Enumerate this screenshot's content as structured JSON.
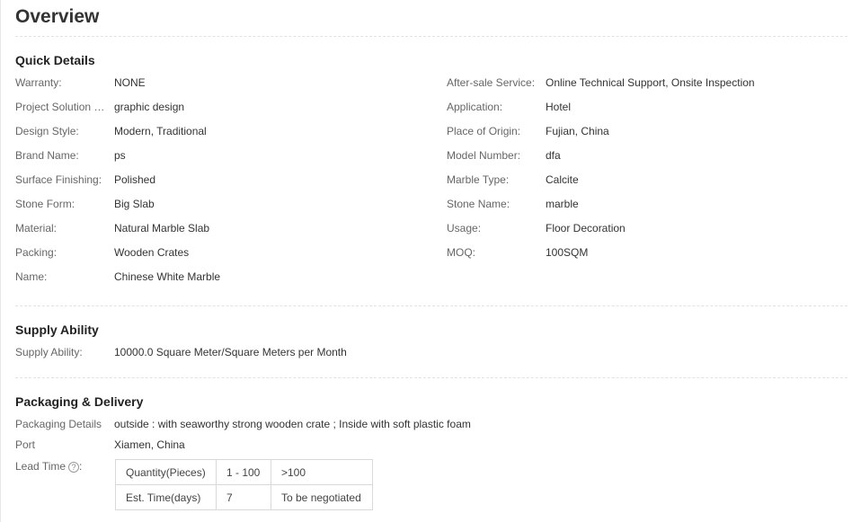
{
  "page_title": "Overview",
  "quick_details": {
    "title": "Quick Details",
    "left": [
      {
        "label": "Warranty:",
        "value": "NONE"
      },
      {
        "label": "Project Solution Ca...",
        "value": "graphic design"
      },
      {
        "label": "Design Style:",
        "value": "Modern, Traditional"
      },
      {
        "label": "Brand Name:",
        "value": "ps"
      },
      {
        "label": "Surface Finishing:",
        "value": "Polished"
      },
      {
        "label": "Stone Form:",
        "value": "Big Slab"
      },
      {
        "label": "Material:",
        "value": "Natural Marble Slab"
      },
      {
        "label": "Packing:",
        "value": "Wooden Crates"
      },
      {
        "label": "Name:",
        "value": "Chinese White Marble"
      }
    ],
    "right": [
      {
        "label": "After-sale Service:",
        "value": "Online Technical Support, Onsite Inspection"
      },
      {
        "label": "Application:",
        "value": "Hotel"
      },
      {
        "label": "Place of Origin:",
        "value": "Fujian, China"
      },
      {
        "label": "Model Number:",
        "value": "dfa"
      },
      {
        "label": "Marble Type:",
        "value": "Calcite"
      },
      {
        "label": "Stone Name:",
        "value": "marble"
      },
      {
        "label": "Usage:",
        "value": "Floor Decoration"
      },
      {
        "label": "MOQ:",
        "value": "100SQM"
      }
    ]
  },
  "supply_ability": {
    "title": "Supply Ability",
    "label": "Supply Ability:",
    "value": "10000.0 Square Meter/Square Meters per Month"
  },
  "packaging_delivery": {
    "title": "Packaging & Delivery",
    "packaging_details_label": "Packaging Details",
    "packaging_details_value": "outside : with seaworthy strong wooden crate ; Inside with soft plastic foam",
    "port_label": "Port",
    "port_value": "Xiamen, China",
    "lead_time_label": "Lead Time",
    "help_icon": "question-circle-icon",
    "help_glyph": "?",
    "lead_time_colon": ":",
    "lead_table": [
      [
        "Quantity(Pieces)",
        "1 - 100",
        ">100"
      ],
      [
        "Est. Time(days)",
        "7",
        "To be negotiated"
      ]
    ]
  }
}
